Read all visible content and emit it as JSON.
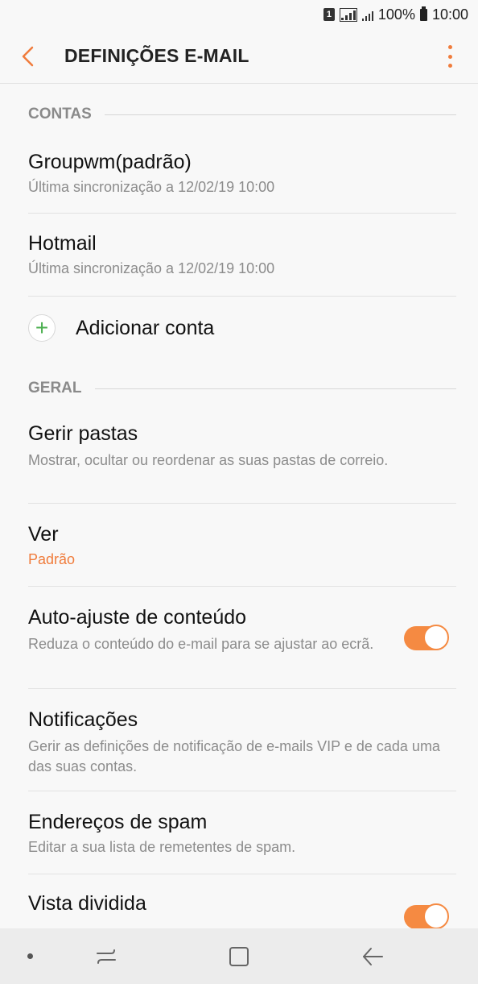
{
  "status_bar": {
    "sim_label": "1",
    "battery": "100%",
    "time": "10:00"
  },
  "header": {
    "title": "DEFINIÇÕES E-MAIL"
  },
  "sections": {
    "accounts": {
      "title": "CONTAS",
      "items": [
        {
          "title": "Groupwm(padrão)",
          "subtitle": "Última sincronização a 12/02/19  10:00"
        },
        {
          "title": "Hotmail",
          "subtitle": "Última sincronização a 12/02/19  10:00"
        }
      ],
      "add_label": "Adicionar conta"
    },
    "general": {
      "title": "GERAL",
      "items": [
        {
          "title": "Gerir pastas",
          "subtitle": "Mostrar, ocultar ou reordenar as suas pastas de correio."
        },
        {
          "title": "Ver",
          "subtitle": "Padrão"
        },
        {
          "title": "Auto-ajuste de conteúdo",
          "subtitle": "Reduza o conteúdo do e-mail para se ajustar ao ecrã.",
          "toggle_on": true
        },
        {
          "title": "Notificações",
          "subtitle": "Gerir as definições de notificação de e-mails VIP e de cada uma das suas contas."
        },
        {
          "title": "Endereços de spam",
          "subtitle": "Editar a sua lista de remetentes de spam."
        },
        {
          "title": "Vista dividida",
          "toggle_on": true
        }
      ]
    }
  },
  "colors": {
    "accent": "#f07c3c",
    "toggle": "#f58a42",
    "plus": "#4caf50"
  },
  "icons": [
    "back-arrow-icon",
    "more-options-icon",
    "plus-icon",
    "recent-apps-icon",
    "home-icon",
    "back-icon"
  ]
}
